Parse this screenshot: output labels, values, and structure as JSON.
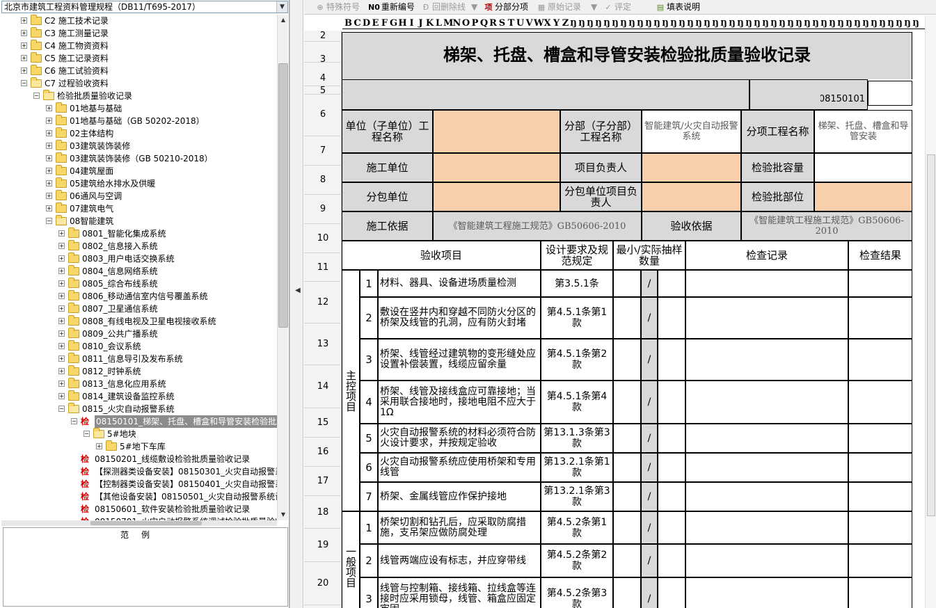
{
  "project_combo": "北京市建筑工程资料管理规程（DB11/T695-2017）",
  "tree": {
    "nodes": [
      {
        "label": "C2 施工技术记录",
        "level": 0,
        "open": false,
        "check": false
      },
      {
        "label": "C3 施工测量记录",
        "level": 0,
        "open": false,
        "check": false
      },
      {
        "label": "C4 施工物资资料",
        "level": 0,
        "open": false,
        "check": false
      },
      {
        "label": "C5 施工记录资料",
        "level": 0,
        "open": false,
        "check": false
      },
      {
        "label": "C6 施工试验资料",
        "level": 0,
        "open": false,
        "check": false
      },
      {
        "label": "C7 过程验收资料",
        "level": 0,
        "open": true,
        "check": false
      },
      {
        "label": "检验批质量验收记录",
        "level": 1,
        "open": true,
        "check": false
      },
      {
        "label": "01地基与基础",
        "level": 2,
        "open": false,
        "check": false
      },
      {
        "label": "01地基与基础（GB 50202-2018）",
        "level": 2,
        "open": false,
        "check": false
      },
      {
        "label": "02主体结构",
        "level": 2,
        "open": false,
        "check": false
      },
      {
        "label": "03建筑装饰装修",
        "level": 2,
        "open": false,
        "check": false
      },
      {
        "label": "03建筑装饰装修（GB 50210-2018）",
        "level": 2,
        "open": false,
        "check": false
      },
      {
        "label": "04建筑屋面",
        "level": 2,
        "open": false,
        "check": false
      },
      {
        "label": "05建筑给水排水及供暖",
        "level": 2,
        "open": false,
        "check": false
      },
      {
        "label": "06通风与空调",
        "level": 2,
        "open": false,
        "check": false
      },
      {
        "label": "07建筑电气",
        "level": 2,
        "open": false,
        "check": false
      },
      {
        "label": "08智能建筑",
        "level": 2,
        "open": true,
        "check": false
      },
      {
        "label": "0801_智能化集成系统",
        "level": 3,
        "open": false,
        "check": false
      },
      {
        "label": "0802_信息接入系统",
        "level": 3,
        "open": false,
        "check": false
      },
      {
        "label": "0803_用户电话交换系统",
        "level": 3,
        "open": false,
        "check": false
      },
      {
        "label": "0804_信息网络系统",
        "level": 3,
        "open": false,
        "check": false
      },
      {
        "label": "0805_综合布线系统",
        "level": 3,
        "open": false,
        "check": false
      },
      {
        "label": "0806_移动通信室内信号覆盖系统",
        "level": 3,
        "open": false,
        "check": false
      },
      {
        "label": "0807_卫星通信系统",
        "level": 3,
        "open": false,
        "check": false
      },
      {
        "label": "0808_有线电视及卫星电视接收系统",
        "level": 3,
        "open": false,
        "check": false
      },
      {
        "label": "0809_公共广播系统",
        "level": 3,
        "open": false,
        "check": false
      },
      {
        "label": "0810_会议系统",
        "level": 3,
        "open": false,
        "check": false
      },
      {
        "label": "0811_信息导引及发布系统",
        "level": 3,
        "open": false,
        "check": false
      },
      {
        "label": "0812_时钟系统",
        "level": 3,
        "open": false,
        "check": false
      },
      {
        "label": "0813_信息化应用系统",
        "level": 3,
        "open": false,
        "check": false
      },
      {
        "label": "0814_建筑设备监控系统",
        "level": 3,
        "open": false,
        "check": false
      },
      {
        "label": "0815_火灾自动报警系统",
        "level": 3,
        "open": true,
        "check": false
      },
      {
        "label": "08150101_梯架、托盘、槽盒和导管安装检验批质",
        "level": 4,
        "open": true,
        "check": true,
        "selected": true
      },
      {
        "label": "5#地块",
        "level": 5,
        "open": true,
        "check": false
      },
      {
        "label": "5#地下车库",
        "level": 6,
        "open": false,
        "check": false
      },
      {
        "label": "08150201_线缆敷设检验批质量验收记录",
        "level": 4,
        "open": null,
        "check": true
      },
      {
        "label": "【探测器类设备安装】08150301_火灾自动报警系",
        "level": 4,
        "open": null,
        "check": true
      },
      {
        "label": "【控制器类设备安装】08150401_火灾自动报警系",
        "level": 4,
        "open": null,
        "check": true
      },
      {
        "label": "【其他设备安装】08150501_火灾自动报警系统设",
        "level": 4,
        "open": null,
        "check": true
      },
      {
        "label": "08150601_软件安装检验批质量验收记录",
        "level": 4,
        "open": null,
        "check": true
      },
      {
        "label": "08150701_火灾自动报警系统调试检验批质量验收",
        "level": 4,
        "open": null,
        "check": true
      }
    ],
    "check_mark": "检"
  },
  "legend_title": "范例",
  "toolbar": {
    "special_symbol": "特殊符号",
    "renumber": "重新编号",
    "delete_line": "回删除线",
    "sub_items": "分部分项",
    "original_record": "原始记录",
    "evaluate": "评定",
    "fill_guide": "填表说明"
  },
  "columns": [
    "B",
    "C",
    "D",
    "E",
    "F",
    "G",
    "H",
    "I",
    "J",
    "K",
    "L",
    "M",
    "N",
    "O",
    "P",
    "Q",
    "R",
    "S",
    "T",
    "U",
    "V",
    "W",
    "X",
    "Y",
    "Z"
  ],
  "row_numbers": [
    "2",
    "3",
    "4",
    "5",
    "6",
    "7",
    "8",
    "9",
    "10",
    "11",
    "12",
    "13",
    "14",
    "15",
    "16",
    "17",
    "18",
    "19",
    "20"
  ],
  "form": {
    "title": "梯架、托盘、槽盒和导管安装检验批质量验收记录",
    "code": "08150101",
    "unit_name_label": "单位（子单位）工程名称",
    "division_label": "分部（子分部）工程名称",
    "division_value": "智能建筑/火灾自动报警系统",
    "subitem_label": "分项工程名称",
    "subitem_value": "梯架、托盘、槽盒和导管安装",
    "constructor_label": "施工单位",
    "pm_label": "项目负责人",
    "capacity_label": "检验批容量",
    "subcontractor_label": "分包单位",
    "sub_pm_label": "分包单位项目负责人",
    "location_label": "检验批部位",
    "basis_label": "施工依据",
    "basis_value": "《智能建筑工程施工规范》GB50606-2010",
    "acceptance_label": "验收依据",
    "acceptance_value": "《智能建筑工程施工规范》GB50606-2010",
    "hdr_item": "验收项目",
    "hdr_design": "设计要求及规范规定",
    "hdr_sample": "最小/实际抽样数量",
    "hdr_record": "检查记录",
    "hdr_result": "检查结果",
    "main_control": "主控项目",
    "general": "一般项目",
    "main_items": [
      {
        "no": "1",
        "text": "材料、器具、设备进场质量检测",
        "clause": "第3.5.1条"
      },
      {
        "no": "2",
        "text": "敷设在竖井内和穿越不同防火分区的桥架及线管的孔洞，应有防火封堵",
        "clause": "第4.5.1条第1款"
      },
      {
        "no": "3",
        "text": "桥架、线管经过建筑物的变形缝处应设置补偿装置，线缆应留余量",
        "clause": "第4.5.1条第2款"
      },
      {
        "no": "4",
        "text": "桥架、线管及接线盒应可靠接地；当采用联合接地时，接地电阻不应大于1Ω",
        "clause": "第4.5.1条第4款"
      },
      {
        "no": "5",
        "text": "火灾自动报警系统的材料必须符合防火设计要求，并按规定验收",
        "clause": "第13.1.3条第3款"
      },
      {
        "no": "6",
        "text": "火灾自动报警系统应使用桥架和专用线管",
        "clause": "第13.2.1条第1款"
      },
      {
        "no": "7",
        "text": "桥架、金属线管应作保护接地",
        "clause": "第13.2.1条第3款"
      }
    ],
    "general_items": [
      {
        "no": "1",
        "text": "桥架切割和钻孔后，应采取防腐措施，支吊架应做防腐处理",
        "clause": "第4.5.2条第1款"
      },
      {
        "no": "2",
        "text": "线管两端应设有标志，并应穿带线",
        "clause": "第4.5.2条第2款"
      },
      {
        "no": "3",
        "text": "线管与控制箱、接线箱、拉线盒等连接时应采用锁母，线管、箱盒应固定牢固",
        "clause": "第4.5.2条第3款"
      }
    ],
    "slash": "/"
  }
}
